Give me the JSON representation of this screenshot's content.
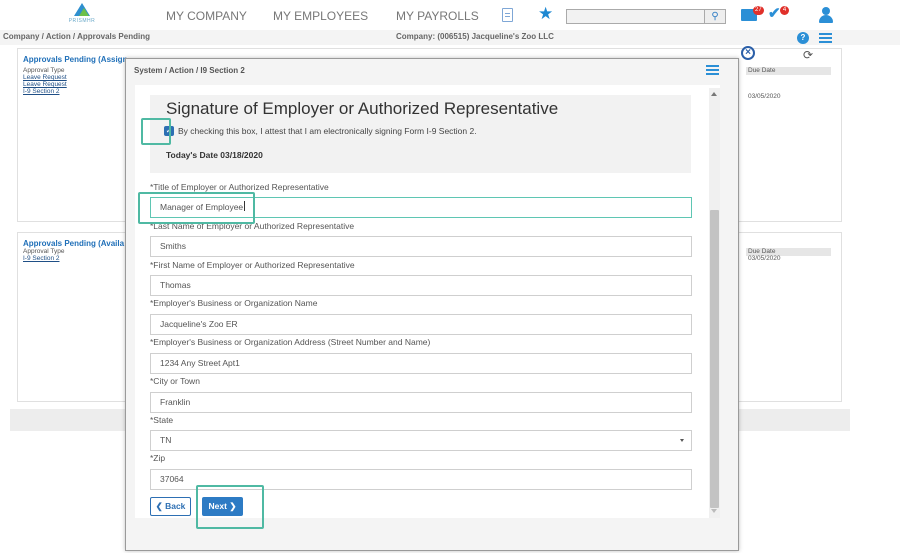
{
  "nav": {
    "logo_text": "PRISMHR",
    "links": [
      "MY COMPANY",
      "MY EMPLOYEES",
      "MY PAYROLLS"
    ],
    "search_placeholder": "",
    "mail_badge": "27",
    "approvals_badge": "4",
    "icons": [
      "document-icon",
      "star-icon",
      "search-icon",
      "mail-icon",
      "approvals-icon",
      "user-icon"
    ]
  },
  "breadcrumb": "Company / Action / Approvals Pending",
  "company": "Company: (006515) Jacqueline's Zoo LLC",
  "panels": [
    {
      "title": "Approvals Pending (Assign",
      "sub": "Approval Type",
      "links": [
        "Leave Request",
        "Leave Request",
        "I-9 Section 2"
      ],
      "due_header": "Due Date",
      "due_value": "03/05/2020"
    },
    {
      "title": "Approvals Pending (Availa",
      "sub": "Approval Type",
      "links": [
        "I-9 Section 2"
      ],
      "due_header": "Due Date",
      "due_value": "03/05/2020"
    }
  ],
  "modal": {
    "title": "System / Action / I9 Section 2",
    "signature": {
      "heading": "Signature of Employer or Authorized Representative",
      "checkbox_checked": true,
      "checkbox_label": "By checking this box, I attest that I am electronically signing Form I-9 Section 2.",
      "date_text": "Today's Date 03/18/2020"
    },
    "fields": [
      {
        "label": "*Title of Employer or Authorized Representative",
        "value": "Manager of Employee"
      },
      {
        "label": "*Last Name of Employer or Authorized Representative",
        "value": "Smiths"
      },
      {
        "label": "*First Name of Employer or Authorized Representative",
        "value": "Thomas"
      },
      {
        "label": "*Employer's Business or Organization Name",
        "value": "Jacqueline's Zoo ER"
      },
      {
        "label": "*Employer's Business or Organization Address (Street Number and Name)",
        "value": "1234 Any Street Apt1"
      },
      {
        "label": "*City or Town",
        "value": "Franklin"
      },
      {
        "label": "*State",
        "value": "TN"
      },
      {
        "label": "*Zip",
        "value": "37064"
      }
    ],
    "back_label": "Back",
    "next_label": "Next"
  },
  "colors": {
    "accent": "#2d7bc4",
    "highlight": "#4fb9a3",
    "badge": "#e0302a"
  }
}
